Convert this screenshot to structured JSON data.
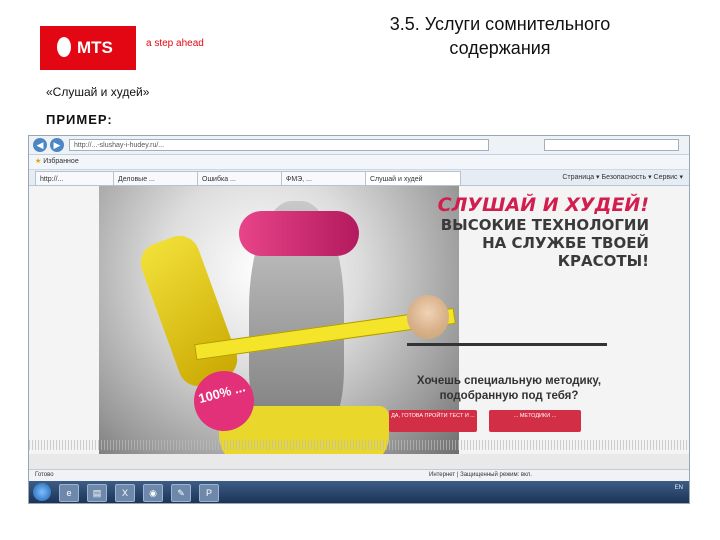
{
  "slide": {
    "brand": "MTS",
    "tagline": "a step ahead",
    "title": "3.5. Услуги сомнительного содержания",
    "subtitle": "«Слушай и худей»",
    "example_label": "ПРИМЕР:",
    "accent_color": "#e30613"
  },
  "browser": {
    "address": "http://...-slushay-i-hudey.ru/...",
    "search_placeholder": "",
    "favorites_label": "Избранное",
    "tabs": [
      {
        "label": "http://...",
        "active": false
      },
      {
        "label": "Деловые ...",
        "active": false
      },
      {
        "label": "Ошибка ...",
        "active": false
      },
      {
        "label": "ФМЭ, ...",
        "active": false
      },
      {
        "label": "Слушай и худей",
        "active": true
      }
    ],
    "toolbar_tools": "Страница ▾  Безопасность ▾  Сервис ▾",
    "status_left": "Готово",
    "status_right": "Интернет | Защищенный режим: вкл."
  },
  "page": {
    "headline_1": "СЛУШАЙ И ХУДЕЙ!",
    "headline_2": "ВЫСОКИЕ ТЕХНОЛОГИИ",
    "headline_3": "НА СЛУЖБЕ ТВОЕЙ",
    "headline_4": "КРАСОТЫ!",
    "badge_text": "100% ...",
    "question": "Хочешь специальную методику, подобранную под тебя?",
    "cta_left": "ДА, ГОТОВА ПРОЙТИ ТЕСТ И ...",
    "cta_right": "... МЕТОДИКИ ..."
  },
  "taskbar": {
    "clock": "",
    "lang": "EN"
  }
}
